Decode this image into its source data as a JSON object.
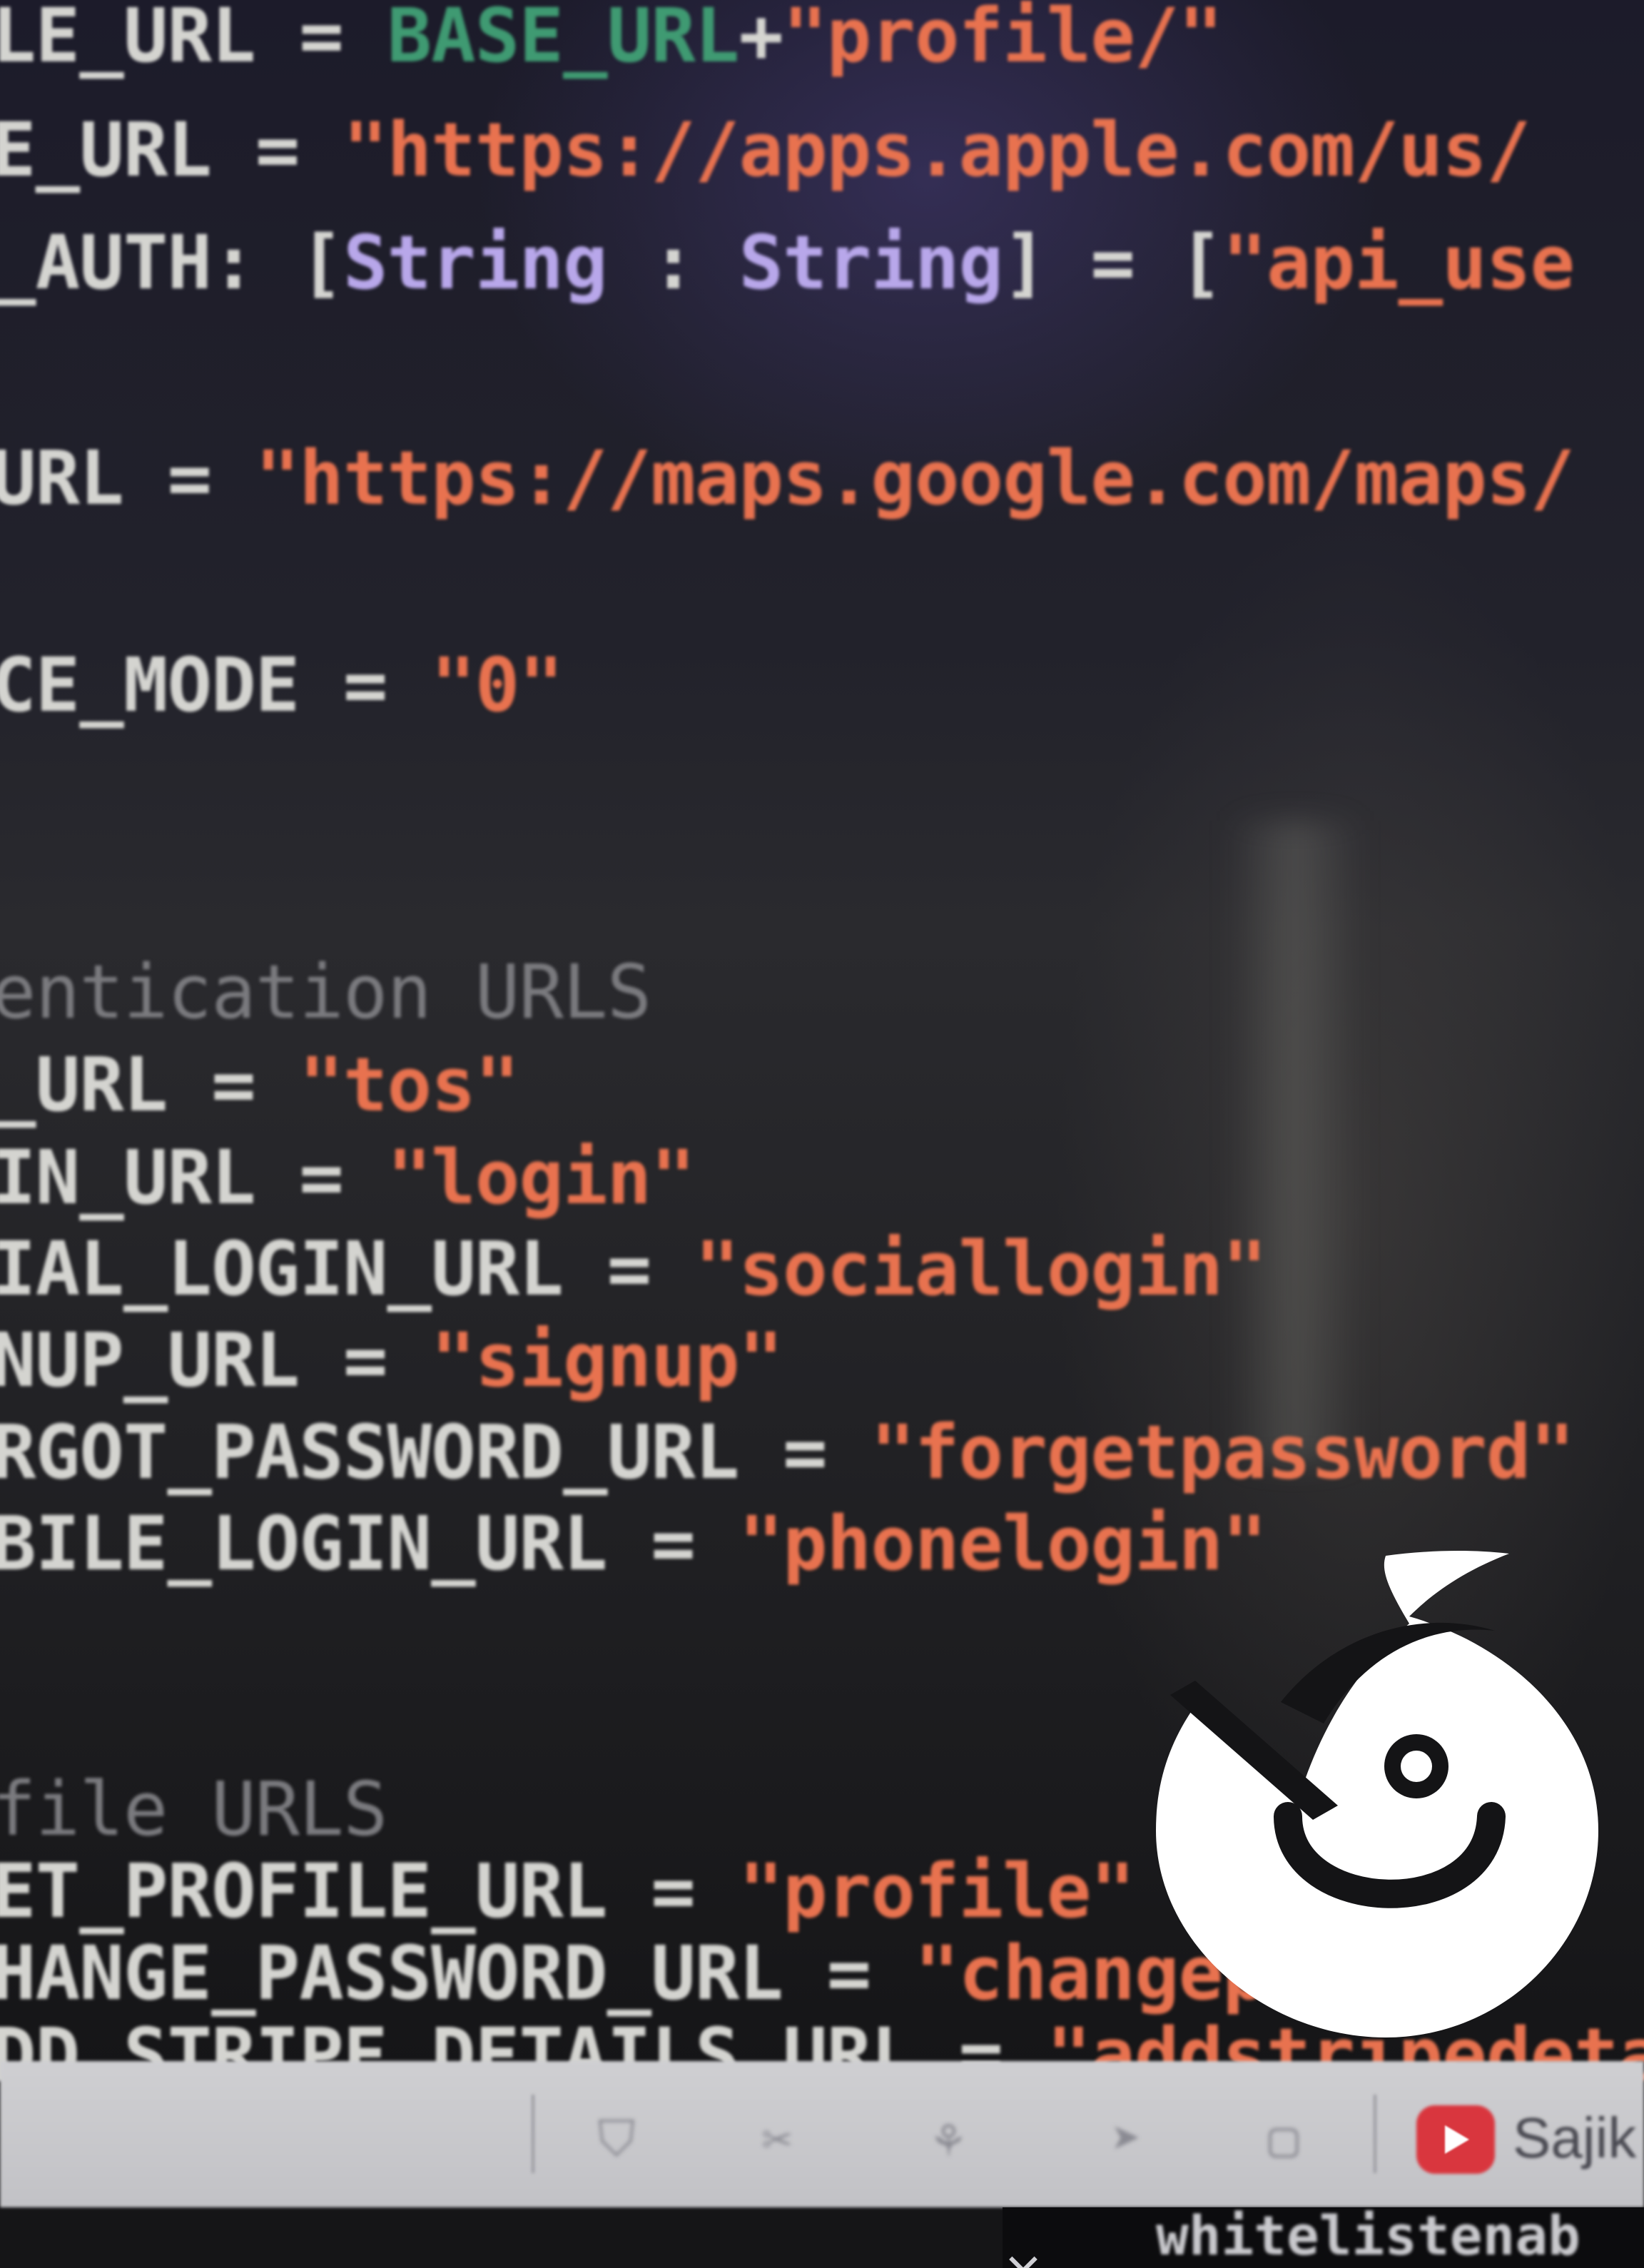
{
  "code_lines": [
    {
      "id": "profile-url",
      "parts": [
        {
          "t": "LE_URL",
          "c": "ident"
        },
        {
          "t": " = ",
          "c": "op"
        },
        {
          "t": "BASE_URL",
          "c": "plain"
        },
        {
          "t": "+",
          "c": "op"
        },
        {
          "t": "\"profile/\"",
          "c": "str"
        }
      ]
    },
    {
      "id": "store-url",
      "parts": [
        {
          "t": "E_URL",
          "c": "ident"
        },
        {
          "t": " = ",
          "c": "op"
        },
        {
          "t": "\"https://apps.apple.com/us/",
          "c": "str"
        }
      ]
    },
    {
      "id": "auth",
      "parts": [
        {
          "t": "_AUTH:",
          "c": "ident"
        },
        {
          "t": " [",
          "c": "op"
        },
        {
          "t": "String",
          "c": "type"
        },
        {
          "t": " : ",
          "c": "op"
        },
        {
          "t": "String",
          "c": "type"
        },
        {
          "t": "] = [",
          "c": "op"
        },
        {
          "t": "\"api_use",
          "c": "str"
        }
      ]
    },
    {
      "id": "maps-url",
      "parts": [
        {
          "t": "URL",
          "c": "ident"
        },
        {
          "t": " = ",
          "c": "op"
        },
        {
          "t": "\"https://maps.google.com/maps/",
          "c": "str"
        }
      ]
    },
    {
      "id": "mode",
      "parts": [
        {
          "t": "CE_MODE",
          "c": "ident"
        },
        {
          "t": " = ",
          "c": "op"
        },
        {
          "t": "\"0\"",
          "c": "str"
        }
      ]
    },
    {
      "id": "auth-comment",
      "parts": [
        {
          "t": "entication URLS",
          "c": "comment"
        }
      ]
    },
    {
      "id": "tos",
      "parts": [
        {
          "t": "_URL",
          "c": "ident"
        },
        {
          "t": " = ",
          "c": "op"
        },
        {
          "t": "\"tos\"",
          "c": "str"
        }
      ]
    },
    {
      "id": "login",
      "parts": [
        {
          "t": "IN_URL",
          "c": "ident"
        },
        {
          "t": " = ",
          "c": "op"
        },
        {
          "t": "\"login\"",
          "c": "str"
        }
      ]
    },
    {
      "id": "social-login",
      "parts": [
        {
          "t": "IAL_LOGIN_URL",
          "c": "ident"
        },
        {
          "t": " = ",
          "c": "op"
        },
        {
          "t": "\"sociallogin\"",
          "c": "str"
        }
      ]
    },
    {
      "id": "signup",
      "parts": [
        {
          "t": "NUP_URL",
          "c": "ident"
        },
        {
          "t": " = ",
          "c": "op"
        },
        {
          "t": "\"signup\"",
          "c": "str"
        }
      ]
    },
    {
      "id": "forgot",
      "parts": [
        {
          "t": "RGOT_PASSWORD_URL",
          "c": "ident"
        },
        {
          "t": " = ",
          "c": "op"
        },
        {
          "t": "\"forgetpassword\"",
          "c": "str"
        }
      ]
    },
    {
      "id": "mobile-login",
      "parts": [
        {
          "t": "BILE_LOGIN_URL",
          "c": "ident"
        },
        {
          "t": " = ",
          "c": "op"
        },
        {
          "t": "\"phonelogin\"",
          "c": "str"
        }
      ]
    },
    {
      "id": "profile-comment",
      "parts": [
        {
          "t": "file URLS",
          "c": "comment"
        }
      ]
    },
    {
      "id": "get-profile",
      "parts": [
        {
          "t": "ET_PROFILE_URL",
          "c": "ident"
        },
        {
          "t": " = ",
          "c": "op"
        },
        {
          "t": "\"profile\"",
          "c": "str"
        }
      ]
    },
    {
      "id": "change-password",
      "parts": [
        {
          "t": "HANGE_PASSWORD_URL",
          "c": "ident"
        },
        {
          "t": " = ",
          "c": "op"
        },
        {
          "t": "\"changepas",
          "c": "str"
        }
      ]
    },
    {
      "id": "stripe",
      "parts": [
        {
          "t": "DD_STRIPE_DETAILS_URL",
          "c": "ident"
        },
        {
          "t": " = ",
          "c": "op"
        },
        {
          "t": "\"addstripedetails\"",
          "c": "str"
        }
      ]
    }
  ],
  "taskbar": {
    "youtube_label": "Sajik",
    "terminal_text": "whitelistenab"
  },
  "colors": {
    "string": "#e8724f",
    "identifier": "#d4d4d0",
    "type": "#b8a7ea",
    "comment": "#7a7a7e",
    "base_ref": "#3f9a72"
  }
}
